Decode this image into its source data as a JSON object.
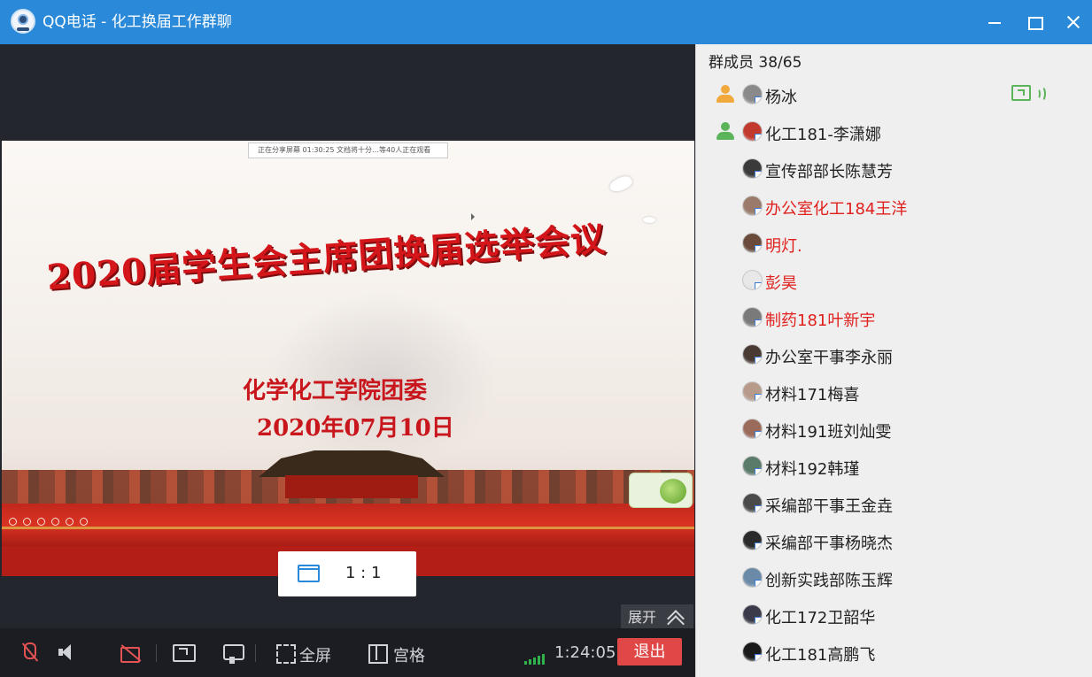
{
  "window": {
    "title": "QQ电话 - 化工换届工作群聊",
    "app_icon": "webcam-icon"
  },
  "slide": {
    "banner_text": "正在分享屏幕 01:30:25 文档将十分…等40人正在观看",
    "heading": "2020届学生会主席团换届选举会议",
    "organization": "化学化工学院团委",
    "date": "2020年07月10日"
  },
  "video_controls": {
    "ratio_label": "1 : 1",
    "expand_label": "展开"
  },
  "toolbar": {
    "fullscreen_label": "全屏",
    "grid_label": "宫格",
    "call_duration": "1:24:05",
    "hangup_label": "退出",
    "icons": [
      "mic-muted-icon",
      "speaker-icon",
      "camera-off-icon",
      "screen-share-icon",
      "video-record-icon",
      "fullscreen-icon",
      "grid-icon",
      "signal-strength-icon"
    ]
  },
  "members": {
    "header": "群成员 38/65",
    "list": [
      {
        "name": "杨冰",
        "role": "host",
        "avatar_color": "#8a8a8a",
        "sharing": true,
        "name_color": "default"
      },
      {
        "name": "化工181-李潇娜",
        "role": "admin",
        "avatar_color": "#c23a2e",
        "sharing": false,
        "name_color": "default"
      },
      {
        "name": "宣传部部长陈慧芳",
        "role": "member",
        "avatar_color": "#3a3a3a",
        "sharing": false,
        "name_color": "default"
      },
      {
        "name": "办公室化工184王洋",
        "role": "member",
        "avatar_color": "#9a7a6a",
        "sharing": false,
        "name_color": "red"
      },
      {
        "name": "明灯.",
        "role": "member",
        "avatar_color": "#6a4a3a",
        "sharing": false,
        "name_color": "red"
      },
      {
        "name": "彭昊",
        "role": "member",
        "avatar_color": "#e8e8e8",
        "sharing": false,
        "name_color": "red"
      },
      {
        "name": "制药181叶新宇",
        "role": "member",
        "avatar_color": "#7a7a7a",
        "sharing": false,
        "name_color": "red"
      },
      {
        "name": "办公室干事李永丽",
        "role": "member",
        "avatar_color": "#4a3a34",
        "sharing": false,
        "name_color": "default"
      },
      {
        "name": "材料171梅喜",
        "role": "member",
        "avatar_color": "#b89a8a",
        "sharing": false,
        "name_color": "default"
      },
      {
        "name": "材料191班刘灿雯",
        "role": "member",
        "avatar_color": "#9a6a5a",
        "sharing": false,
        "name_color": "default"
      },
      {
        "name": "材料192韩瑾",
        "role": "member",
        "avatar_color": "#5a7a6a",
        "sharing": false,
        "name_color": "default"
      },
      {
        "name": "采编部干事王金垚",
        "role": "member",
        "avatar_color": "#4a4a4a",
        "sharing": false,
        "name_color": "default"
      },
      {
        "name": "采编部干事杨晓杰",
        "role": "member",
        "avatar_color": "#2a2a2a",
        "sharing": false,
        "name_color": "default"
      },
      {
        "name": "创新实践部陈玉辉",
        "role": "member",
        "avatar_color": "#6a8aa8",
        "sharing": false,
        "name_color": "default"
      },
      {
        "name": "化工172卫韶华",
        "role": "member",
        "avatar_color": "#3a3a4a",
        "sharing": false,
        "name_color": "default"
      },
      {
        "name": "化工181高鹏飞",
        "role": "member",
        "avatar_color": "#1a1a1a",
        "sharing": false,
        "name_color": "default"
      }
    ]
  },
  "colors": {
    "titlebar": "#2a8ad9",
    "hangup": "#e04848",
    "signal": "#2fb34a",
    "red_name": "#e0201d"
  }
}
